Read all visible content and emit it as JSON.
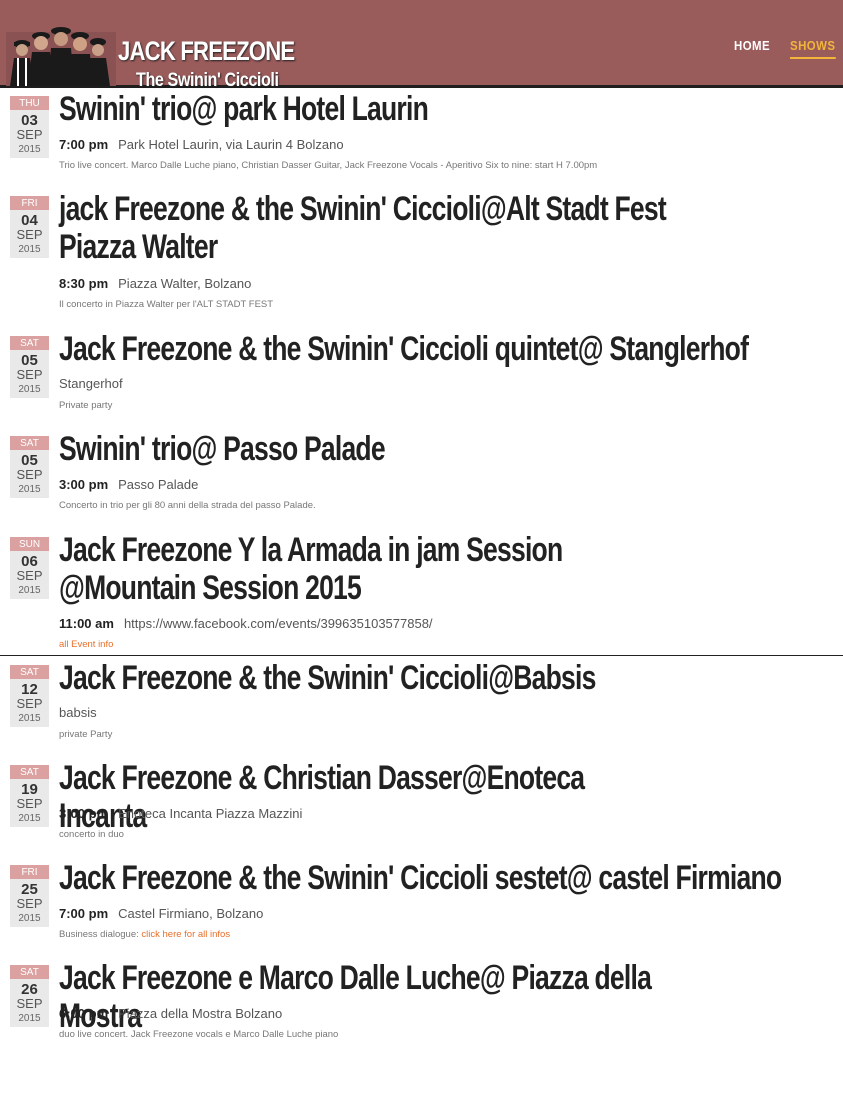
{
  "brand": {
    "title": "JACK FREEZONE",
    "subtitle": "The Swinin' Ciccioli"
  },
  "nav": {
    "home": "HOME",
    "shows": "SHOWS"
  },
  "colors": {
    "header_bg": "#9a5b5b",
    "active_nav": "#f2b53a",
    "date_header": "#dba0a0",
    "link": "#e8702a"
  },
  "events": [
    {
      "dow": "THU",
      "day": "03",
      "month": "SEP",
      "year": "2015",
      "title": "Swinin' trio@ park Hotel Laurin",
      "time": "7:00 pm",
      "venue": "Park Hotel Laurin, via Laurin 4 Bolzano",
      "desc": "Trio live concert. Marco Dalle Luche piano, Christian Dasser Guitar, Jack Freezone Vocals - Aperitivo Six to nine: start H 7.00pm"
    },
    {
      "dow": "FRI",
      "day": "04",
      "month": "SEP",
      "year": "2015",
      "title": "jack Freezone & the Swinin' Ciccioli@Alt Stadt Fest Piazza Walter",
      "time": "8:30 pm",
      "venue": "Piazza Walter, Bolzano",
      "desc": "Il concerto in Piazza Walter per l'ALT STADT FEST"
    },
    {
      "dow": "SAT",
      "day": "05",
      "month": "SEP",
      "year": "2015",
      "title": "Jack Freezone & the Swinin' Ciccioli quintet@ Stanglerhof",
      "time": "",
      "venue": "Stangerhof",
      "desc": "Private party"
    },
    {
      "dow": "SAT",
      "day": "05",
      "month": "SEP",
      "year": "2015",
      "title": "Swinin' trio@ Passo Palade",
      "time": "3:00 pm",
      "venue": "Passo Palade",
      "desc": "Concerto in trio per gli 80 anni della strada del passo Palade."
    },
    {
      "dow": "SUN",
      "day": "06",
      "month": "SEP",
      "year": "2015",
      "title": "Jack Freezone Y la Armada in jam Session @Mountain Session 2015",
      "time": "11:00 am",
      "venue": "https://www.facebook.com/events/399635103577858/",
      "link": "all Event info"
    },
    {
      "dow": "SAT",
      "day": "12",
      "month": "SEP",
      "year": "2015",
      "title": "Jack Freezone & the Swinin' Ciccioli@Babsis",
      "time": "",
      "venue": "babsis",
      "desc": "private Party"
    },
    {
      "dow": "SAT",
      "day": "19",
      "month": "SEP",
      "year": "2015",
      "title": "Jack Freezone & Christian Dasser@Enoteca Incanta",
      "time": "3:00 pm",
      "venue": "Enoteca Incanta Piazza Mazzini",
      "desc": "concerto in duo"
    },
    {
      "dow": "FRI",
      "day": "25",
      "month": "SEP",
      "year": "2015",
      "title": "Jack Freezone & the Swinin' Ciccioli sestet@ castel Firmiano",
      "time": "7:00 pm",
      "venue": "Castel Firmiano, Bolzano",
      "desc": "Business dialogue:",
      "link": "click here for all infos"
    },
    {
      "dow": "SAT",
      "day": "26",
      "month": "SEP",
      "year": "2015",
      "title": "Jack Freezone e Marco Dalle Luche@ Piazza della Mostra",
      "time": "6:00 pm",
      "venue": "Piazza della Mostra Bolzano",
      "desc": "duo live concert. Jack Freezone vocals e Marco Dalle Luche piano"
    }
  ]
}
